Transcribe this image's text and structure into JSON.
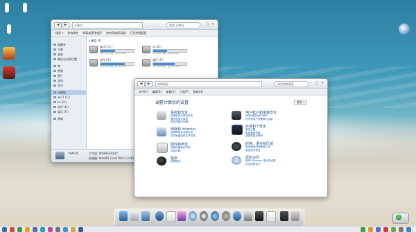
{
  "explorer": {
    "address": "计算机",
    "search_placeholder": "搜索 计算机",
    "menu": [
      "组织 ▾",
      "系统属性",
      "卸载或更改程序",
      "映射网络驱动器",
      "打开控制面板"
    ],
    "sidebar": [
      "收藏夹",
      "下载",
      "桌面",
      "最近访问的位置",
      "库",
      "视频",
      "图片",
      "文档",
      "音乐",
      "计算机",
      "win7 (C:)",
      "vs (D:)",
      "文件 (E:)",
      "娱乐 (F:)",
      "网络"
    ],
    "section_title": "▴ 硬盘 (4)",
    "drives": [
      {
        "name": "win7 (C:)",
        "free": "22.0 GB 可用，共 39.0 GB",
        "usage": 0.44
      },
      {
        "name": "vs (D:)",
        "free": "23.6 GB 可用，共 40.0 GB",
        "usage": 0.41
      },
      {
        "name": "文件 (E:)",
        "free": "15.9 GB 可用，共 60.0 GB",
        "usage": 0.73
      },
      {
        "name": "娱乐 (F:)",
        "free": "21.1 GB 可用，共 58.0 GB",
        "usage": 0.64
      }
    ],
    "status_name": "YHM-PC",
    "status_workgroup": "工作组: WORKGROUP",
    "status_cpu": "处理器: Intel(R) Core(TM) i5-2410M"
  },
  "control_panel": {
    "address": "控制面板",
    "search_placeholder": "搜索控制面板",
    "menu": [
      "文件(F)",
      "编辑(E)",
      "查看(V)",
      "工具(T)",
      "帮助(H)"
    ],
    "header": "调整计算机的设置",
    "view_by": "类别 ▾",
    "categories": [
      {
        "title": "系统和安全",
        "links": [
          "查看您的计算机状态",
          "备份您的计算机",
          "查找并解决问题"
        ]
      },
      {
        "title": "用户帐户和家庭安全",
        "links": [
          "添加或删除用户帐户",
          "为所有用户设置家长控制"
        ]
      },
      {
        "title": "网络和 Internet",
        "links": [
          "查看网络状态和任务",
          "选择家庭组和共享选项"
        ]
      },
      {
        "title": "外观和个性化",
        "links": [
          "更改主题",
          "更改桌面背景",
          "调整屏幕分辨率"
        ]
      },
      {
        "title": "硬件和声音",
        "links": [
          "查看设备和打印机",
          "添加设备"
        ]
      },
      {
        "title": "时钟、语言和区域",
        "links": [
          "更改键盘或其他输入法",
          "更改显示语言"
        ]
      },
      {
        "title": "程序",
        "links": [
          "卸载程序"
        ]
      },
      {
        "title": "轻松访问",
        "links": [
          "使用 Windows 建议的设置",
          "优化视频显示"
        ]
      }
    ]
  },
  "taskbar": {
    "tray_badge": "0"
  },
  "colors": {
    "link": "#2266bb",
    "selection": "#b8cfe9",
    "sea": "#3f98b9",
    "sand": "#e6dfd0"
  },
  "icons": {
    "dock": [
      "finder-icon",
      "mail-icon",
      "photo-icon",
      "home-icon",
      "music-icon",
      "browser-icon",
      "chat-icon",
      "media-icon",
      "settings-icon",
      "calendar-icon",
      "trash-icon"
    ]
  }
}
